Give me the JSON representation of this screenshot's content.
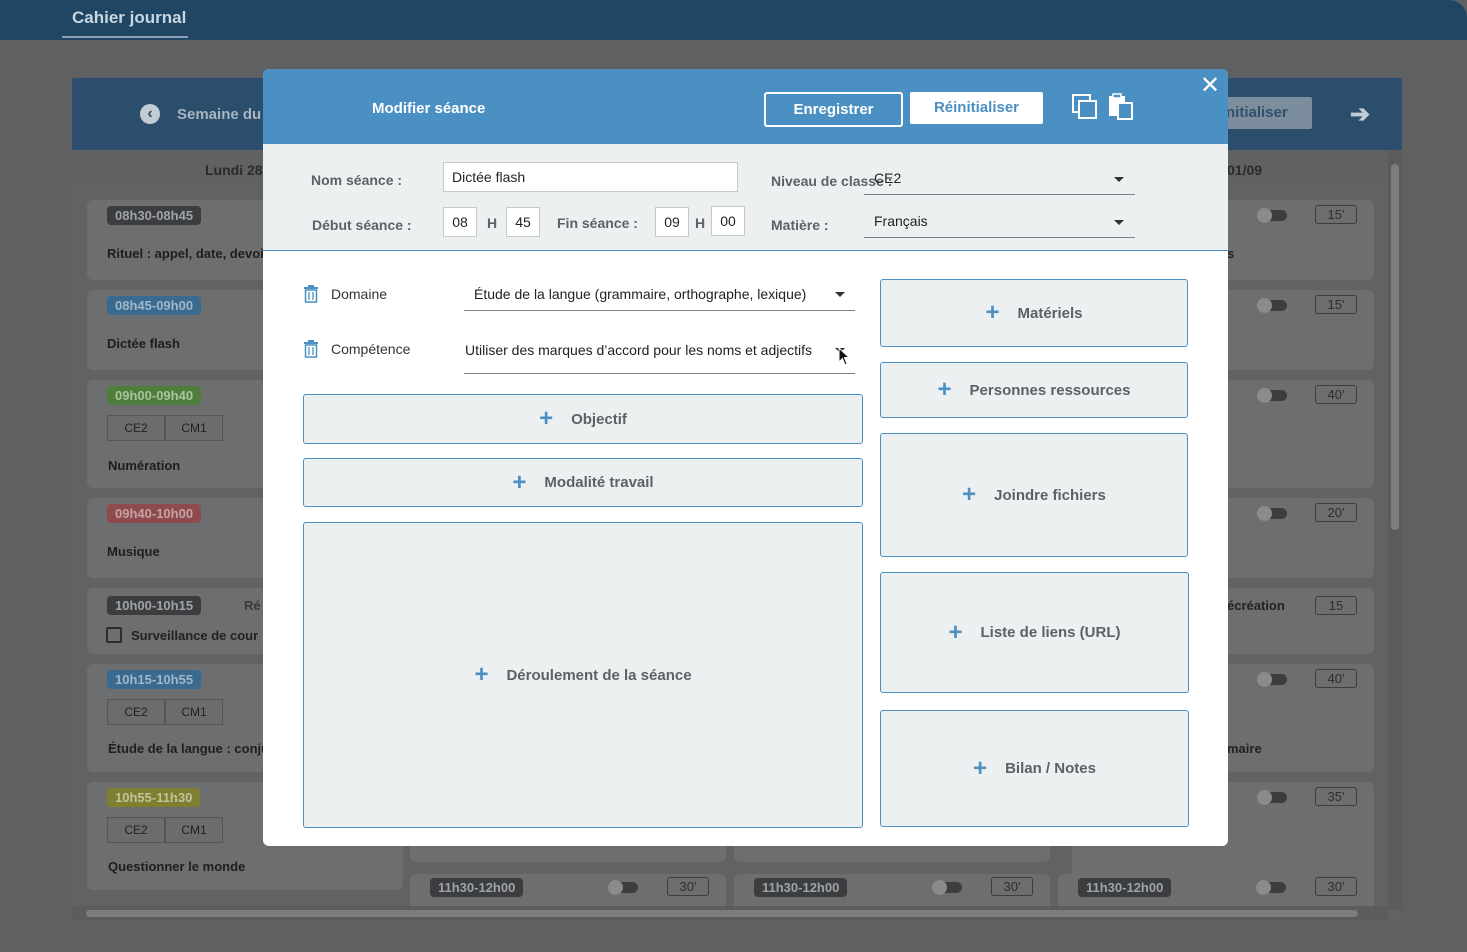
{
  "app": {
    "title": "Cahier journal"
  },
  "planner": {
    "week_label": "Semaine du 2",
    "reset_label_partial": "nitialiser",
    "days": [
      {
        "label": "Lundi 28/"
      },
      {
        "label": "01/09"
      }
    ],
    "cards_left": [
      {
        "time": "08h30-08h45",
        "title": "Rituel : appel, date, devoirs"
      },
      {
        "time": "08h45-09h00",
        "title": "Dictée flash"
      },
      {
        "time": "09h00-09h40",
        "title": "Numération",
        "tags": [
          "CE2",
          "CM1"
        ]
      },
      {
        "time": "09h40-10h00",
        "title": "Musique"
      },
      {
        "time": "10h00-10h15",
        "title": "Surveillance de cour",
        "extra": "Ré"
      },
      {
        "time": "10h15-10h55",
        "title": "Étude de la langue : conjug",
        "tags": [
          "CE2",
          "CM1"
        ]
      },
      {
        "time": "10h55-11h30",
        "title": "Questionner le monde",
        "tags": [
          "CE2",
          "CM1"
        ]
      }
    ],
    "cards_right": [
      {
        "dur": "15'"
      },
      {
        "dur": "15'",
        "text": "s"
      },
      {
        "dur": "40'"
      },
      {
        "dur": "20'"
      },
      {
        "dur": "15",
        "text": "écréation"
      },
      {
        "dur": "40'",
        "text": "maire"
      },
      {
        "dur": "35'"
      }
    ],
    "bottom_cards": [
      {
        "time": "11h30-12h00",
        "dur": "30'"
      },
      {
        "time": "11h30-12h00",
        "dur": "30'"
      },
      {
        "time": "11h30-12h00",
        "dur": "30'"
      }
    ]
  },
  "modal": {
    "title": "Modifier séance",
    "save_label": "Enregistrer",
    "reset_label": "Réinitialiser",
    "close_glyph": "✕",
    "form": {
      "name_label": "Nom séance :",
      "name_value": "Dictée flash",
      "level_label": "Niveau de classe :",
      "level_value": "CE2",
      "start_label": "Début séance :",
      "start_h": "08",
      "start_m": "45",
      "h_sep": "H",
      "end_label": "Fin séance :",
      "end_h": "09",
      "end_m": "00",
      "subject_label": "Matière :",
      "subject_value": "Français"
    },
    "domain_label": "Domaine",
    "domain_value": "Étude de la langue (grammaire, orthographe, lexique)",
    "competence_label": "Compétence",
    "competence_value": "Utiliser des marques d’accord pour les noms et adjectifs",
    "sections_left": [
      "Objectif",
      "Modalité travail",
      "Déroulement de la séance"
    ],
    "sections_right": [
      "Matériels",
      "Personnes ressources",
      "Joindre fichiers",
      "Liste de liens (URL)",
      "Bilan / Notes"
    ],
    "plus_glyph": "+"
  },
  "colors": {
    "accent": "#4a90c2",
    "header_dark": "#1f4665",
    "panel": "#edf0f1"
  }
}
